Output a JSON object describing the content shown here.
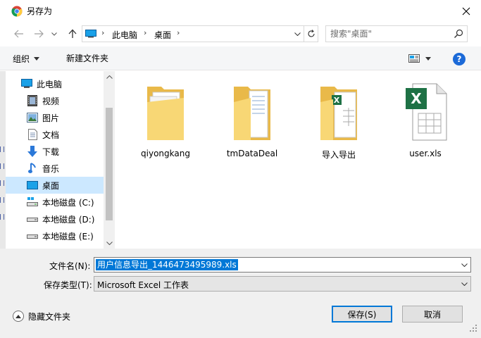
{
  "window": {
    "title": "另存为"
  },
  "address": {
    "crumbs": [
      "此电脑",
      "桌面"
    ]
  },
  "search": {
    "placeholder": "搜索\"桌面\""
  },
  "toolbar": {
    "organize_label": "组织",
    "new_folder_label": "新建文件夹",
    "help_label": "?"
  },
  "nav": {
    "items": [
      {
        "label": "此电脑",
        "icon": "computer-icon"
      },
      {
        "label": "视频",
        "icon": "video-icon"
      },
      {
        "label": "图片",
        "icon": "pictures-icon"
      },
      {
        "label": "文档",
        "icon": "documents-icon"
      },
      {
        "label": "下载",
        "icon": "download-icon"
      },
      {
        "label": "音乐",
        "icon": "music-icon"
      },
      {
        "label": "桌面",
        "icon": "desktop-icon",
        "selected": true
      },
      {
        "label": "本地磁盘 (C:)",
        "icon": "drive-c-icon"
      },
      {
        "label": "本地磁盘 (D:)",
        "icon": "drive-icon"
      },
      {
        "label": "本地磁盘 (E:)",
        "icon": "drive-icon"
      }
    ]
  },
  "files": [
    {
      "name": "qiyongkang",
      "icon": "folder-icon"
    },
    {
      "name": "tmDataDeal",
      "icon": "folder-icon"
    },
    {
      "name": "导入导出",
      "icon": "folder-excel-icon"
    },
    {
      "name": "user.xls",
      "icon": "excel-file-icon"
    }
  ],
  "form": {
    "filename_label": "文件名(N):",
    "filename_value": "用户信息导出_1446473495989.xls",
    "filetype_label": "保存类型(T):",
    "filetype_value": "Microsoft Excel 工作表"
  },
  "footer": {
    "hide_folders_label": "隐藏文件夹",
    "save_label": "保存(S)",
    "cancel_label": "取消"
  },
  "colors": {
    "accent": "#0078d7",
    "selected_bg": "#cce8ff",
    "folder": "#f8d775",
    "excel_green": "#1e7145"
  }
}
